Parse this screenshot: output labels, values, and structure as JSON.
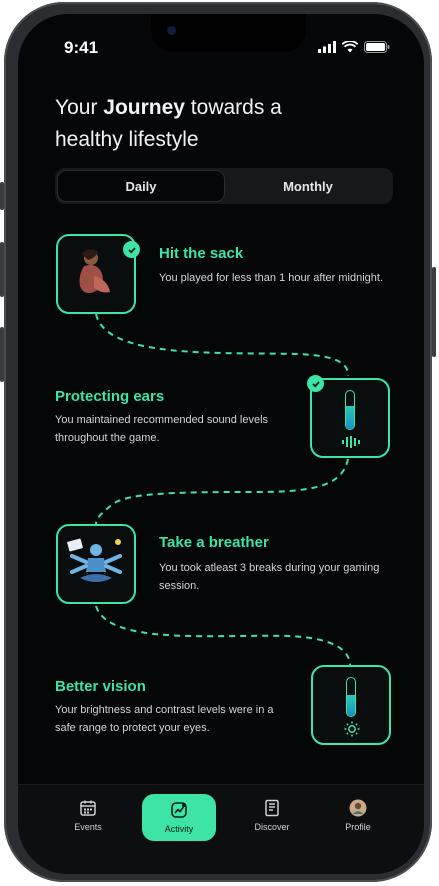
{
  "status": {
    "time": "9:41"
  },
  "header": {
    "title_prefix": "Your ",
    "title_bold": "Journey",
    "title_suffix": " towards a healthy lifestyle"
  },
  "tabs": [
    {
      "label": "Daily",
      "active": true
    },
    {
      "label": "Monthly",
      "active": false
    }
  ],
  "milestones": [
    {
      "title": "Hit the sack",
      "desc": "You played for less than 1 hour after midnight.",
      "completed": true
    },
    {
      "title": "Protecting ears",
      "desc": "You maintained recommended sound levels throughout the game.",
      "completed": true,
      "level": 0.6
    },
    {
      "title": "Take a breather",
      "desc": "You took atleast 3 breaks during your gaming session.",
      "completed": false
    },
    {
      "title": "Better vision",
      "desc": "Your brightness and contrast levels were in a safe range to protect your eyes.",
      "completed": false,
      "level": 0.55
    }
  ],
  "nav": [
    {
      "label": "Events",
      "icon": "calendar-icon",
      "active": false
    },
    {
      "label": "Activity",
      "icon": "activity-icon",
      "active": true
    },
    {
      "label": "Discover",
      "icon": "news-icon",
      "active": false
    },
    {
      "label": "Profile",
      "icon": "avatar-icon",
      "active": false
    }
  ],
  "colors": {
    "accent": "#3ee3a6",
    "background": "#050607",
    "text": "#d3d5d8"
  }
}
